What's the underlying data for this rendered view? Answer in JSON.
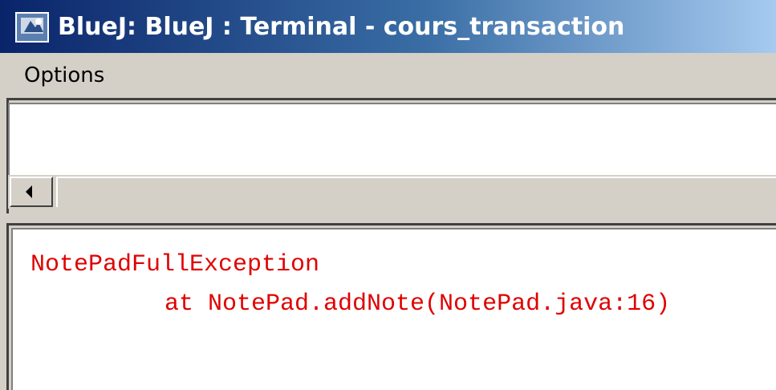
{
  "window": {
    "title": "BlueJ: BlueJ : Terminal - cours_transaction",
    "icon": "bluej-terminal-icon"
  },
  "menubar": {
    "items": [
      {
        "label": "Options"
      }
    ]
  },
  "upper_panel": {
    "scrollbar": {
      "left_arrow_icon": "arrow-left-icon"
    }
  },
  "output": {
    "lines": [
      "NotePadFullException",
      "at NotePad.addNote(NotePad.java:16)"
    ],
    "text_color": "#e00000"
  }
}
